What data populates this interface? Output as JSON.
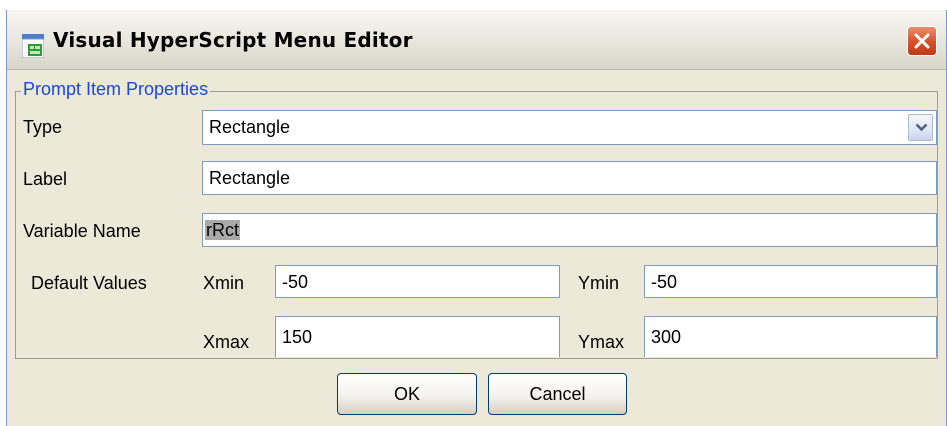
{
  "window": {
    "title": "Visual HyperScript Menu Editor",
    "app_icon": "app-window-icon",
    "close_icon": "close-icon"
  },
  "group": {
    "title": "Prompt Item Properties"
  },
  "fields": {
    "type_label": "Type",
    "type_value": "Rectangle",
    "label_label": "Label",
    "label_value": "Rectangle",
    "variable_label": "Variable Name",
    "variable_value": "rRct",
    "default_values_label": "Default Values",
    "xmin_label": "Xmin",
    "xmin_value": "-50",
    "ymin_label": "Ymin",
    "ymin_value": "-50",
    "xmax_label": "Xmax",
    "xmax_value": "150",
    "ymax_label": "Ymax",
    "ymax_value": "300"
  },
  "buttons": {
    "ok": "OK",
    "cancel": "Cancel"
  },
  "colors": {
    "window_bg": "#ece9d8",
    "group_title": "#1a48d8",
    "close_button": "#d8542f",
    "field_border": "#7f9db9",
    "selection": "#a9a9a9"
  }
}
